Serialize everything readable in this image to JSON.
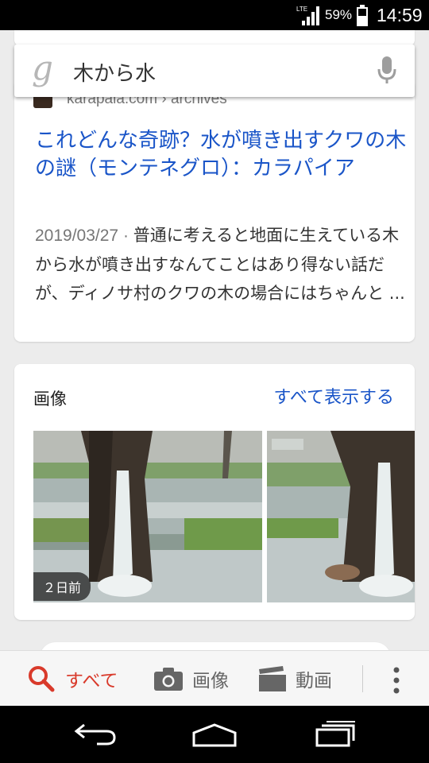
{
  "status_bar": {
    "network": "LTE",
    "battery_percent": "59%",
    "time": "14:59"
  },
  "search": {
    "query": "木から水"
  },
  "result": {
    "source": "karapaia.com › archives",
    "title": "これどんな奇跡？水が噴き出すクワの木の謎（モンテネグロ）：カラパイア",
    "date": "2019/03/27",
    "snippet": "普通に考えると地面に生えている木から水が噴き出すなんてことはあり得ない話だが、ディノサ村のクワの木の場合にはちゃんと ..."
  },
  "images": {
    "heading": "画像",
    "see_all": "すべて表示する",
    "badge": "２日前"
  },
  "tabs": {
    "all": "すべて",
    "images": "画像",
    "video": "動画"
  },
  "colors": {
    "link_blue": "#1a55c8",
    "active_tab_red": "#d93a2b"
  }
}
